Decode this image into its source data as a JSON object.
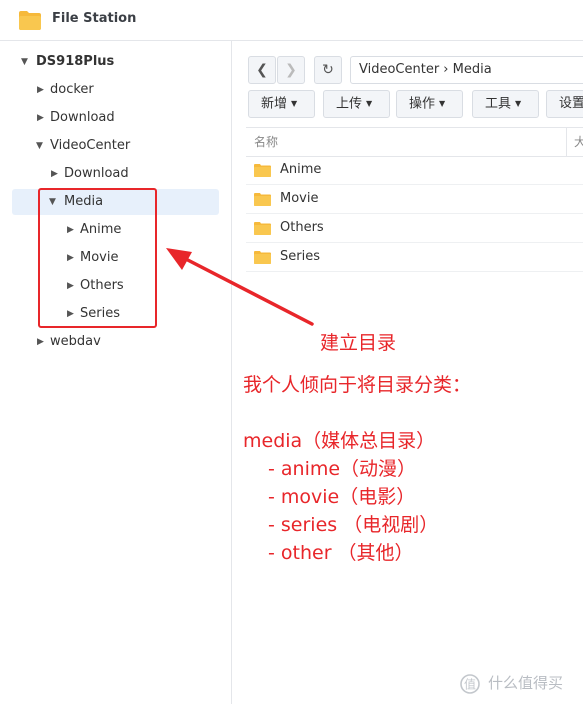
{
  "app": {
    "title": "File Station",
    "accent": "#f6b93b"
  },
  "sidebar": {
    "items": [
      {
        "label": "DS918Plus",
        "expanded": true,
        "bold": true
      },
      {
        "label": "docker",
        "expanded": false
      },
      {
        "label": "Download",
        "expanded": false
      },
      {
        "label": "VideoCenter",
        "expanded": true
      },
      {
        "label": "Download",
        "expanded": false
      },
      {
        "label": "Media",
        "expanded": true,
        "selected": true
      },
      {
        "label": "Anime",
        "expanded": false
      },
      {
        "label": "Movie",
        "expanded": false
      },
      {
        "label": "Others",
        "expanded": false
      },
      {
        "label": "Series",
        "expanded": false
      },
      {
        "label": "webdav",
        "expanded": false
      }
    ]
  },
  "nav": {
    "back_icon": "chevron-left-icon",
    "forward_icon": "chevron-right-icon",
    "refresh_icon": "refresh-icon",
    "path": "VideoCenter › Media"
  },
  "toolbar": {
    "buttons": [
      {
        "label": "新增"
      },
      {
        "label": "上传"
      },
      {
        "label": "操作"
      },
      {
        "label": "工具"
      },
      {
        "label": "设置"
      }
    ]
  },
  "filelist": {
    "columns": {
      "name": "名称",
      "size": "大"
    },
    "rows": [
      {
        "name": "Anime"
      },
      {
        "name": "Movie"
      },
      {
        "name": "Others"
      },
      {
        "name": "Series"
      }
    ]
  },
  "annotation": {
    "color": "#e8262a",
    "arrow_label": "建立目录",
    "intro": "我个人倾向于将目录分类：",
    "lines": [
      "media（媒体总目录）",
      "- anime（动漫）",
      "- movie（电影）",
      "- series （电视剧）",
      "- other  （其他）"
    ]
  },
  "watermark": {
    "text": "什么值得买"
  }
}
